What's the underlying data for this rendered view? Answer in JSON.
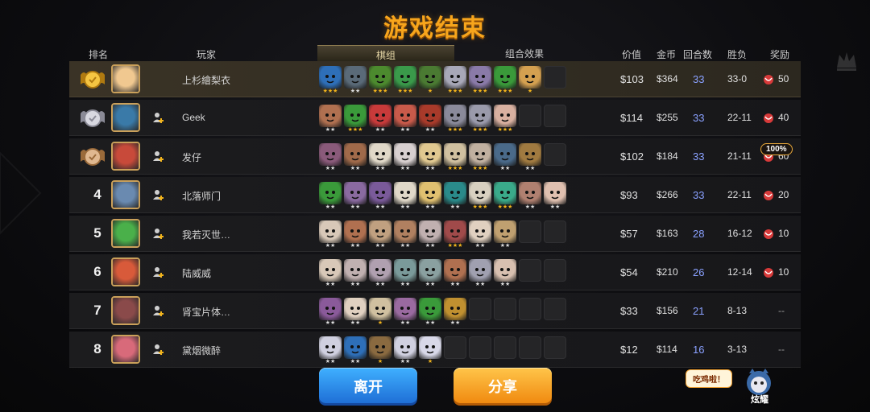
{
  "title": "游戏结束",
  "header": {
    "rank": "排名",
    "player": "玩家",
    "lineup_tab": "棋组",
    "combo_tab": "组合效果",
    "value": "价值",
    "gold": "金币",
    "rounds": "回合数",
    "winloss": "胜负",
    "reward": "奖励"
  },
  "colors": {
    "accent": "#f7a51c",
    "round_text": "#8aa1ff",
    "star": "#f2b41c",
    "star_silver": "#dcdcdc"
  },
  "rows": [
    {
      "rank": "",
      "medal": "gold",
      "name": "上杉繪梨衣",
      "self": true,
      "value": "$103",
      "gold": "$364",
      "rounds": "33",
      "wl": "33-0",
      "reward": "50",
      "pieces": [
        [
          "#2e6fb8",
          "★★★",
          "gold"
        ],
        [
          "#5a6a78",
          "★★",
          "silver"
        ],
        [
          "#4c8a2e",
          "★★★",
          "gold"
        ],
        [
          "#3a9a4a",
          "★★★",
          "gold"
        ],
        [
          "#4a7a32",
          "★",
          "gold"
        ],
        [
          "#a8a8b8",
          "★★★",
          "gold"
        ],
        [
          "#8a7aa8",
          "★★★",
          "gold"
        ],
        [
          "#3a9a3a",
          "★★★",
          "gold"
        ],
        [
          "#d4a050",
          "★",
          "gold"
        ],
        [
          "",
          ""
        ]
      ]
    },
    {
      "rank": "",
      "medal": "silver",
      "name": "Geek",
      "self": false,
      "value": "$114",
      "gold": "$255",
      "rounds": "33",
      "wl": "22-11",
      "reward": "40",
      "pieces": [
        [
          "#b07050",
          "★★",
          "silver"
        ],
        [
          "#3a9a3a",
          "★★★",
          "gold"
        ],
        [
          "#c83a3a",
          "★★",
          "silver"
        ],
        [
          "#c85a4a",
          "★★",
          "silver"
        ],
        [
          "#a83a2a",
          "★★",
          "silver"
        ],
        [
          "#8a8a9a",
          "★★★",
          "gold"
        ],
        [
          "#9a9aaa",
          "★★★",
          "gold"
        ],
        [
          "#d8b0a0",
          "★★★",
          "gold"
        ],
        [
          "",
          ""
        ],
        [
          "",
          ""
        ]
      ]
    },
    {
      "rank": "",
      "medal": "bronze",
      "name": "发仔",
      "self": false,
      "value": "$102",
      "gold": "$184",
      "rounds": "33",
      "wl": "21-11",
      "reward": "60",
      "pieces": [
        [
          "#8a5a7a",
          "★★",
          "silver"
        ],
        [
          "#a06a4a",
          "★★",
          "silver"
        ],
        [
          "#e0d8c8",
          "★★",
          "silver"
        ],
        [
          "#d8d0d0",
          "★★",
          "silver"
        ],
        [
          "#e0c890",
          "★★",
          "silver"
        ],
        [
          "#d0c0a0",
          "★★★",
          "gold"
        ],
        [
          "#c0b0a0",
          "★★★",
          "gold"
        ],
        [
          "#4a6a8a",
          "★★",
          "silver"
        ],
        [
          "#a07a40",
          "★★",
          "silver"
        ],
        [
          "",
          ""
        ]
      ]
    },
    {
      "rank": "4",
      "medal": "",
      "name": "北落师门",
      "self": false,
      "value": "$93",
      "gold": "$266",
      "rounds": "33",
      "wl": "22-11",
      "reward": "20",
      "pieces": [
        [
          "#3a9a3a",
          "★★",
          "silver"
        ],
        [
          "#8a6aa0",
          "★★",
          "silver"
        ],
        [
          "#7a5a9a",
          "★★",
          "silver"
        ],
        [
          "#e0d8c8",
          "★★",
          "silver"
        ],
        [
          "#e0c070",
          "★★",
          "silver"
        ],
        [
          "#2a8a8a",
          "★★",
          "silver"
        ],
        [
          "#d8d0c0",
          "★★★",
          "gold"
        ],
        [
          "#3aaa8a",
          "★★★",
          "gold"
        ],
        [
          "#b08070",
          "★★",
          "silver"
        ],
        [
          "#e0c0b0",
          "★★",
          "silver"
        ]
      ]
    },
    {
      "rank": "5",
      "medal": "",
      "name": "我若灭世…",
      "self": false,
      "value": "$57",
      "gold": "$163",
      "rounds": "28",
      "wl": "16-12",
      "reward": "10",
      "pieces": [
        [
          "#d8c8b8",
          "★★",
          "silver"
        ],
        [
          "#b07050",
          "★★",
          "silver"
        ],
        [
          "#c0a080",
          "★★",
          "silver"
        ],
        [
          "#b08060",
          "★★",
          "silver"
        ],
        [
          "#c0b0b0",
          "★★",
          "silver"
        ],
        [
          "#a04a4a",
          "★★★",
          "gold"
        ],
        [
          "#e0d0c0",
          "★★",
          "silver"
        ],
        [
          "#c0a070",
          "★★",
          "silver"
        ],
        [
          "",
          ""
        ],
        [
          "",
          ""
        ]
      ]
    },
    {
      "rank": "6",
      "medal": "",
      "name": "陆威威",
      "self": false,
      "value": "$54",
      "gold": "$210",
      "rounds": "26",
      "wl": "12-14",
      "reward": "10",
      "pieces": [
        [
          "#d8c8b8",
          "★★",
          "silver"
        ],
        [
          "#c0b0b0",
          "★★",
          "silver"
        ],
        [
          "#b0a0b0",
          "★★",
          "silver"
        ],
        [
          "#7a9a9a",
          "★★",
          "silver"
        ],
        [
          "#8aa0a0",
          "★★",
          "silver"
        ],
        [
          "#b07050",
          "★★",
          "silver"
        ],
        [
          "#a0a0b0",
          "★★",
          "silver"
        ],
        [
          "#d8c0b0",
          "★★",
          "silver"
        ],
        [
          "",
          ""
        ],
        [
          "",
          ""
        ]
      ]
    },
    {
      "rank": "7",
      "medal": "",
      "name": "肾宝片体…",
      "self": false,
      "value": "$33",
      "gold": "$156",
      "rounds": "21",
      "wl": "8-13",
      "reward": "--",
      "pieces": [
        [
          "#8a5a9a",
          "★★",
          "silver"
        ],
        [
          "#e0d0c0",
          "★★",
          "silver"
        ],
        [
          "#d0c0a0",
          "★",
          "gold"
        ],
        [
          "#9a6aa0",
          "★★",
          "silver"
        ],
        [
          "#3a9a3a",
          "★★",
          "silver"
        ],
        [
          "#c09030",
          "★★",
          "silver"
        ],
        [
          "",
          ""
        ],
        [
          "",
          ""
        ],
        [
          "",
          ""
        ],
        [
          "",
          ""
        ]
      ]
    },
    {
      "rank": "8",
      "medal": "",
      "name": "黛烟微醉",
      "self": false,
      "value": "$12",
      "gold": "$114",
      "rounds": "16",
      "wl": "3-13",
      "reward": "--",
      "pieces": [
        [
          "#d0d0e0",
          "★★",
          "silver"
        ],
        [
          "#2e6fb8",
          "★★",
          "silver"
        ],
        [
          "#8a6a40",
          "★",
          "gold"
        ],
        [
          "#d0d0e0",
          "★★",
          "silver"
        ],
        [
          "#d8d8e8",
          "★",
          "gold"
        ],
        [
          "",
          ""
        ],
        [
          "",
          ""
        ],
        [
          "",
          ""
        ],
        [
          "",
          ""
        ],
        [
          "",
          ""
        ]
      ]
    }
  ],
  "bonus_badge": "100%",
  "buttons": {
    "leave": "离开",
    "share": "分享"
  },
  "bubble": "吃鸡啦！",
  "show_off": "炫耀"
}
